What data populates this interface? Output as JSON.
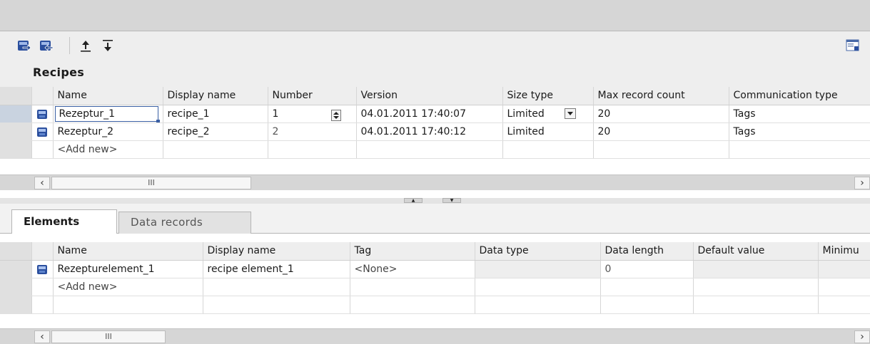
{
  "toolbar": {
    "icons": [
      "export-icon",
      "import-icon",
      "move-up-icon",
      "move-down-icon",
      "view-toggle-icon"
    ]
  },
  "recipes": {
    "title": "Recipes",
    "columns": [
      "Name",
      "Display name",
      "Number",
      "Version",
      "Size type",
      "Max record count",
      "Communication type"
    ],
    "rows": [
      {
        "name": "Rezeptur_1",
        "display_name": "recipe_1",
        "number": "1",
        "version": "04.01.2011 17:40:07",
        "size_type": "Limited",
        "max_record_count": "20",
        "communication_type": "Tags"
      },
      {
        "name": "Rezeptur_2",
        "display_name": "recipe_2",
        "number": "2",
        "version": "04.01.2011 17:40:12",
        "size_type": "Limited",
        "max_record_count": "20",
        "communication_type": "Tags"
      }
    ],
    "add_new": "<Add new>",
    "scroll_thumb": "III"
  },
  "tabs": [
    "Elements",
    "Data records"
  ],
  "elements": {
    "columns": [
      "Name",
      "Display name",
      "Tag",
      "Data type",
      "Data length",
      "Default value",
      "Minimu"
    ],
    "rows": [
      {
        "name": "Rezepturelement_1",
        "display_name": "recipe element_1",
        "tag": "<None>",
        "data_type": "",
        "data_length": "0",
        "default_value": "",
        "minimum": ""
      }
    ],
    "add_new": "<Add new>",
    "scroll_thumb": "III"
  },
  "colors": {
    "accent": "#3a5fa3",
    "header_bg": "#eeeeee",
    "panel_bg": "#d6d6d6"
  }
}
